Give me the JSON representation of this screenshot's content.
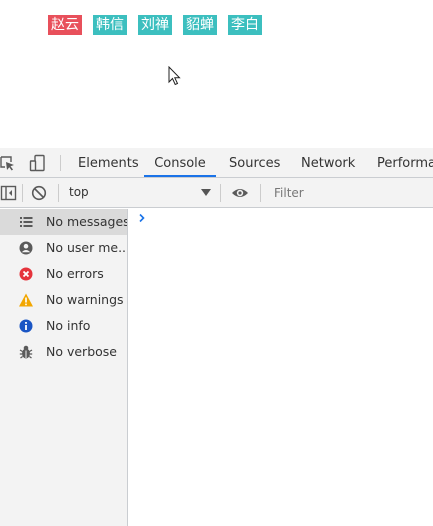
{
  "page": {
    "tags": [
      {
        "label": "赵云",
        "color": "#e8505b"
      },
      {
        "label": "韩信",
        "color": "#3cbfbf"
      },
      {
        "label": "刘禅",
        "color": "#3cbfbf"
      },
      {
        "label": "貂蝉",
        "color": "#3cbfbf"
      },
      {
        "label": "李白",
        "color": "#3cbfbf"
      }
    ]
  },
  "devtools": {
    "tabs": [
      "Elements",
      "Console",
      "Sources",
      "Network",
      "Performan"
    ],
    "active_tab": "Console",
    "toolbar": {
      "context": "top",
      "filter_placeholder": "Filter"
    },
    "sidebar": [
      {
        "label": "No messages",
        "icon": "list-icon"
      },
      {
        "label": "No user me...",
        "icon": "user-icon"
      },
      {
        "label": "No errors",
        "icon": "error-icon"
      },
      {
        "label": "No warnings",
        "icon": "warning-icon"
      },
      {
        "label": "No info",
        "icon": "info-icon"
      },
      {
        "label": "No verbose",
        "icon": "bug-icon"
      }
    ],
    "selected_sidebar": "No messages",
    "colors": {
      "accent": "#1a73e8",
      "error": "#e5333b",
      "warning": "#f2a600",
      "info": "#1a55c4"
    }
  }
}
